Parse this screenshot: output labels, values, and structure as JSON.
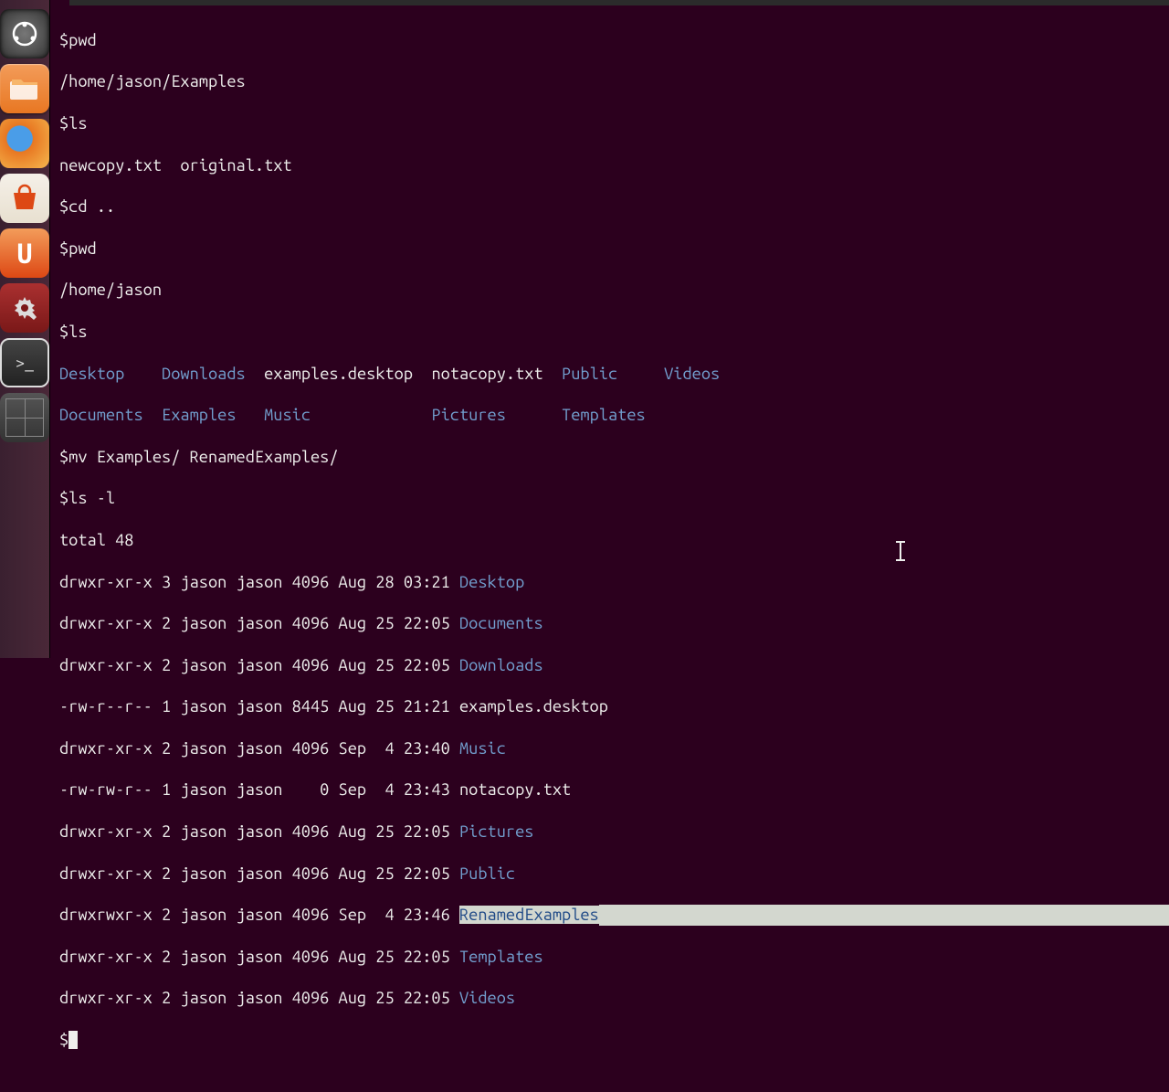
{
  "launcher": {
    "items": [
      {
        "name": "dash",
        "glyph": "◎"
      },
      {
        "name": "files",
        "glyph": ""
      },
      {
        "name": "firefox",
        "glyph": ""
      },
      {
        "name": "software-center",
        "glyph": ""
      },
      {
        "name": "ubuntu-one",
        "glyph": "U"
      },
      {
        "name": "system-settings",
        "glyph": ""
      },
      {
        "name": "terminal",
        "glyph": ">_"
      },
      {
        "name": "workspace-switcher",
        "glyph": ""
      }
    ]
  },
  "terminal": {
    "lines": {
      "l0": "$pwd",
      "l1": "/home/jason/Examples",
      "l2": "$ls",
      "l3a": "newcopy.txt  original.txt",
      "l4": "$cd ..",
      "l5": "$pwd",
      "l6": "/home/jason",
      "l7": "$ls",
      "ls1": {
        "c1": "Desktop",
        "c2": "Downloads",
        "c3": "examples.desktop",
        "c4": "notacopy.txt",
        "c5": "Public",
        "c6": "Videos"
      },
      "ls2": {
        "c1": "Documents",
        "c2": "Examples",
        "c3": "Music",
        "c4": "Pictures",
        "c5": "Templates"
      },
      "l10": "$mv Examples/ RenamedExamples/",
      "l11": "$ls -l",
      "l12": "total 48",
      "r1": {
        "perm": "drwxr-xr-x 3 jason jason 4096 Aug 28 03:21 ",
        "name": "Desktop"
      },
      "r2": {
        "perm": "drwxr-xr-x 2 jason jason 4096 Aug 25 22:05 ",
        "name": "Documents"
      },
      "r3": {
        "perm": "drwxr-xr-x 2 jason jason 4096 Aug 25 22:05 ",
        "name": "Downloads"
      },
      "r4": {
        "perm": "-rw-r--r-- 1 jason jason 8445 Aug 25 21:21 ",
        "name": "examples.desktop"
      },
      "r5": {
        "perm": "drwxr-xr-x 2 jason jason 4096 Sep  4 23:40 ",
        "name": "Music"
      },
      "r6": {
        "perm": "-rw-rw-r-- 1 jason jason    0 Sep  4 23:43 ",
        "name": "notacopy.txt"
      },
      "r7": {
        "perm": "drwxr-xr-x 2 jason jason 4096 Aug 25 22:05 ",
        "name": "Pictures"
      },
      "r8": {
        "perm": "drwxr-xr-x 2 jason jason 4096 Aug 25 22:05 ",
        "name": "Public"
      },
      "r9": {
        "perm": "drwxrwxr-x 2 jason jason 4096 Sep  4 23:46 ",
        "name": "RenamedExamples"
      },
      "r10": {
        "perm": "drwxr-xr-x 2 jason jason 4096 Aug 25 22:05 ",
        "name": "Templates"
      },
      "r11": {
        "perm": "drwxr-xr-x 2 jason jason 4096 Aug 25 22:05 ",
        "name": "Videos"
      },
      "final_prompt": "$"
    }
  }
}
